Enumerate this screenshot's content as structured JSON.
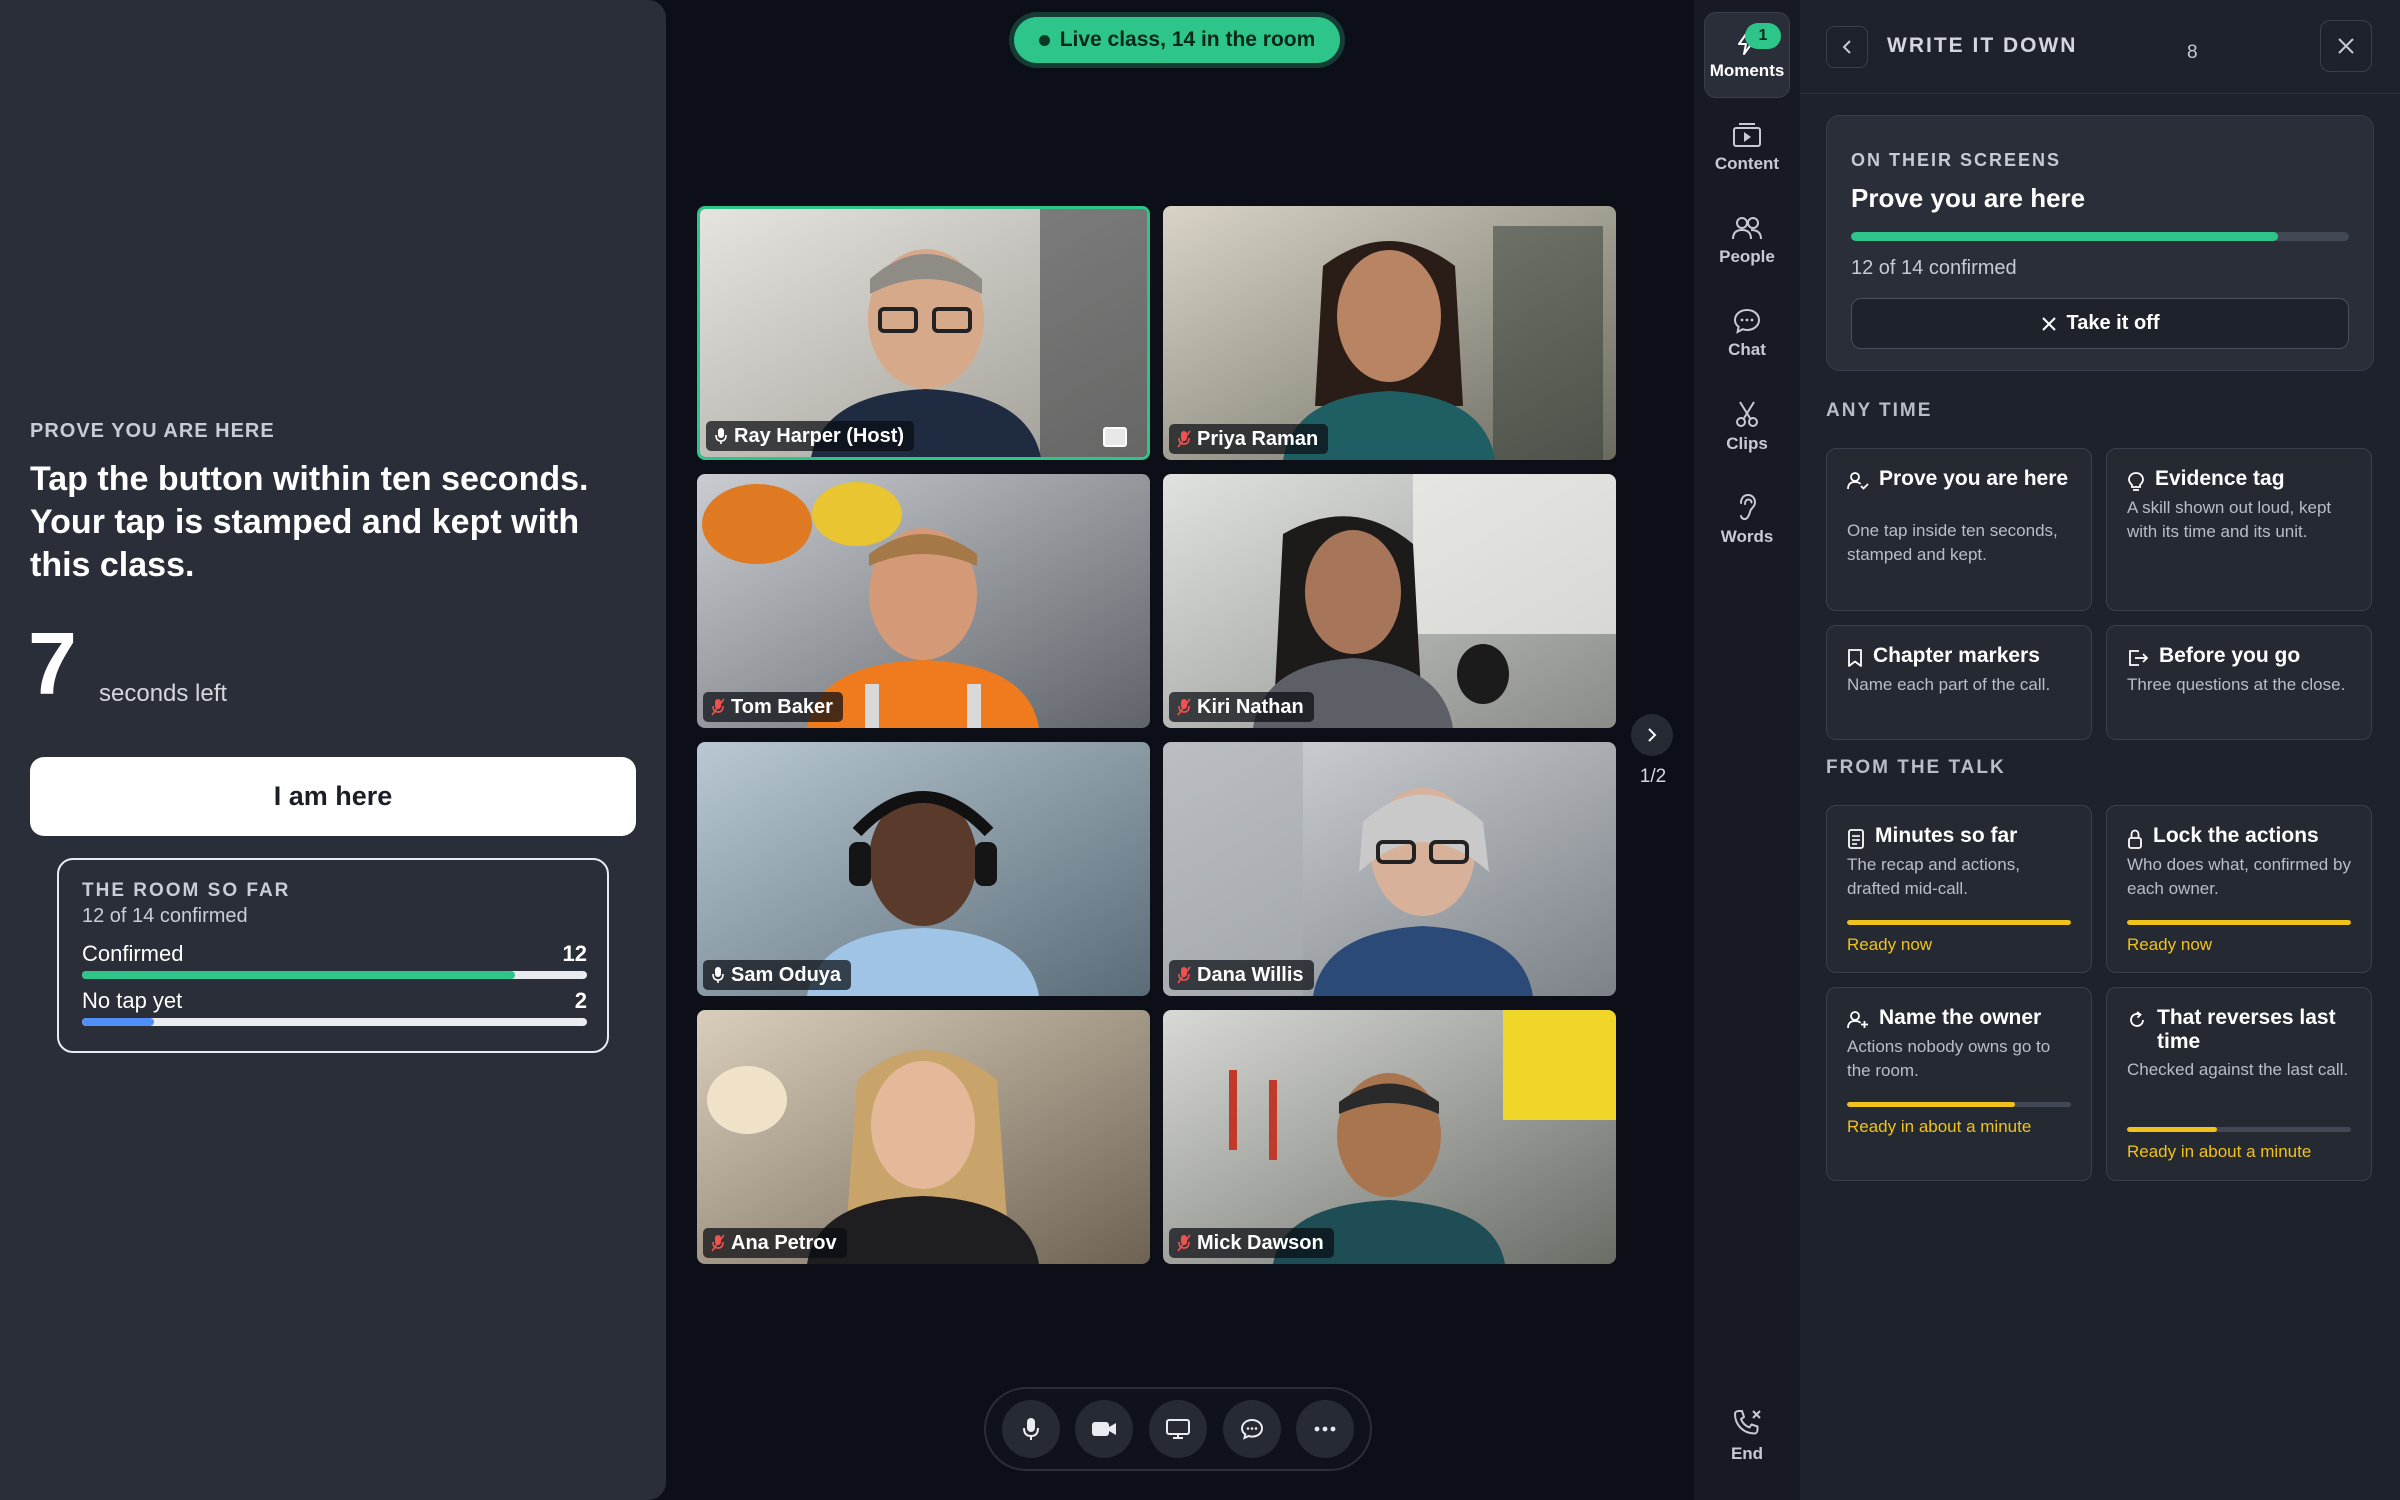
{
  "live": {
    "label": "Live class, 14 in the room"
  },
  "prompt": {
    "eyebrow": "PROVE YOU ARE HERE",
    "heading": "Tap the button within ten seconds. Your tap is stamped and kept with this class.",
    "countdown": "7",
    "countdown_label": "seconds left",
    "button_label": "I am here",
    "room": {
      "title": "THE ROOM SO FAR",
      "subtitle": "12 of 14 confirmed",
      "rows": [
        {
          "label": "Confirmed",
          "value": "12",
          "fraction": 0.857,
          "color": "#2ec58a"
        },
        {
          "label": "No tap yet",
          "value": "2",
          "fraction": 0.143,
          "color": "#4f8ff7"
        }
      ]
    }
  },
  "participants": [
    {
      "name": "Ray Harper (Host)",
      "muted": false,
      "host": true
    },
    {
      "name": "Priya Raman",
      "muted": true,
      "host": false
    },
    {
      "name": "Tom Baker",
      "muted": true,
      "host": false
    },
    {
      "name": "Kiri Nathan",
      "muted": true,
      "host": false
    },
    {
      "name": "Sam Oduya",
      "muted": false,
      "host": false
    },
    {
      "name": "Dana Willis",
      "muted": true,
      "host": false
    },
    {
      "name": "Ana Petrov",
      "muted": true,
      "host": false
    },
    {
      "name": "Mick Dawson",
      "muted": true,
      "host": false
    }
  ],
  "pager": {
    "label": "1/2"
  },
  "rail": {
    "items": [
      {
        "label": "Moments",
        "icon": "bolt-icon",
        "badge": "1",
        "active": true
      },
      {
        "label": "Content",
        "icon": "content-icon"
      },
      {
        "label": "People",
        "icon": "people-icon"
      },
      {
        "label": "Chat",
        "icon": "chat-icon"
      },
      {
        "label": "Clips",
        "icon": "scissors-icon"
      },
      {
        "label": "Words",
        "icon": "ear-icon"
      }
    ],
    "end_label": "End"
  },
  "panel": {
    "title": "WRITE IT DOWN",
    "count": "8",
    "on_screens": {
      "eyebrow": "ON THEIR SCREENS",
      "title": "Prove you are here",
      "fraction": 0.857,
      "subtitle": "12 of 14 confirmed",
      "button_label": "Take it off"
    },
    "any_time_label": "ANY TIME",
    "any_time": [
      {
        "title": "Prove you are here",
        "desc": "One tap inside ten seconds, stamped and kept.",
        "icon": "person-check-icon"
      },
      {
        "title": "Evidence tag",
        "desc": "A skill shown out loud, kept with its time and its unit.",
        "icon": "bulb-icon"
      },
      {
        "title": "Chapter markers",
        "desc": "Name each part of the call.",
        "icon": "bookmark-icon"
      },
      {
        "title": "Before you go",
        "desc": "Three questions at the close.",
        "icon": "exit-icon"
      }
    ],
    "from_talk_label": "FROM THE TALK",
    "from_talk": [
      {
        "title": "Minutes so far",
        "desc": "The recap and actions, drafted mid-call.",
        "status": "Ready now",
        "progress": 1.0,
        "icon": "notes-icon"
      },
      {
        "title": "Lock the actions",
        "desc": "Who does what, confirmed by each owner.",
        "status": "Ready now",
        "progress": 1.0,
        "icon": "lock-icon"
      },
      {
        "title": "Name the owner",
        "desc": "Actions nobody owns go to the room.",
        "status": "Ready in about a minute",
        "progress": 0.75,
        "icon": "person-add-icon"
      },
      {
        "title": "That reverses last time",
        "desc": "Checked against the last call.",
        "status": "Ready in about a minute",
        "progress": 0.4,
        "icon": "refresh-icon"
      }
    ]
  }
}
